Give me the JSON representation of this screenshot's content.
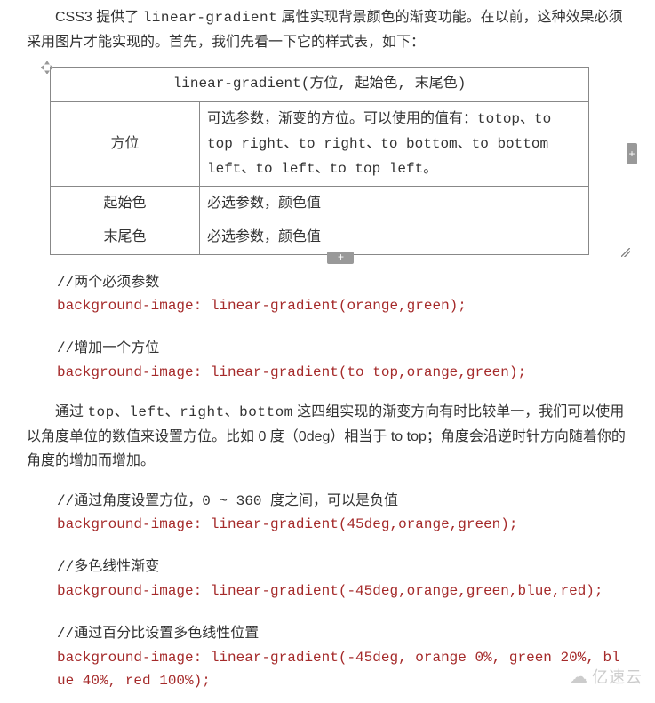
{
  "intro": "CSS3 提供了 linear-gradient 属性实现背景颜色的渐变功能。在以前，这种效果必须采用图片才能实现的。首先，我们先看一下它的样式表，如下：",
  "table": {
    "caption": "linear-gradient(方位, 起始色, 末尾色)",
    "rows": [
      {
        "label": "方位",
        "desc_pre": "可选参数，渐变的方位。可以使用的值有：",
        "desc_code": "totop、to top right、to right、to bottom、to bottom left、to left、to top left",
        "desc_post": "。"
      },
      {
        "label": "起始色",
        "desc_pre": "必选参数，颜色值",
        "desc_code": "",
        "desc_post": ""
      },
      {
        "label": "末尾色",
        "desc_pre": "必选参数，颜色值",
        "desc_code": "",
        "desc_post": ""
      }
    ]
  },
  "code1": {
    "c1": "//两个必须参数",
    "r1": "background-image: linear-gradient(orange,green);",
    "c2": "//增加一个方位",
    "r2": "background-image: linear-gradient(to top,orange,green);"
  },
  "para2": "通过 top、left、right、bottom 这四组实现的渐变方向有时比较单一，我们可以使用以角度单位的数值来设置方位。比如 0 度（0deg）相当于 to top；角度会沿逆时针方向随着你的角度的增加而增加。",
  "code2": {
    "c1": "//通过角度设置方位，0 ~ 360 度之间，可以是负值",
    "r1": "background-image: linear-gradient(45deg,orange,green);",
    "c2": "//多色线性渐变",
    "r2": "background-image: linear-gradient(-45deg,orange,green,blue,red);",
    "c3": "//通过百分比设置多色线性位置",
    "r3": "background-image: linear-gradient(-45deg, orange 0%, green 20%, blue 40%, red 100%);"
  },
  "watermark": "亿速云",
  "handles": {
    "right": "+",
    "bottom": "+"
  }
}
